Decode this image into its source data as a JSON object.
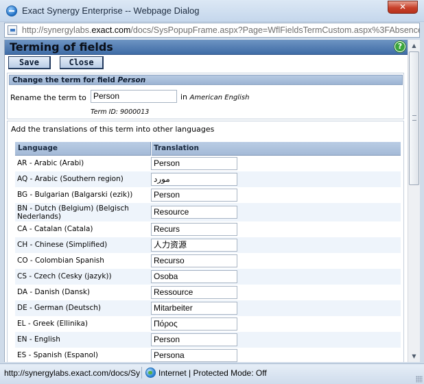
{
  "window": {
    "title": "Exact Synergy Enterprise -- Webpage Dialog",
    "close_glyph": "✕"
  },
  "address": {
    "url_prefix": "http://synergylabs.",
    "url_domain": "exact.com",
    "url_suffix": "/docs/SysPopupFrame.aspx?Page=WflFieldsTermCustom.aspx%3FAbsenceTyp"
  },
  "page": {
    "heading": "Terming of fields",
    "help_glyph": "?",
    "save_label": "Save",
    "close_label": "Close"
  },
  "change_term": {
    "header_prefix": "Change the term for field ",
    "field_name": "Person",
    "rename_label": "Rename the term to",
    "rename_value": "Person",
    "in_prefix": "in ",
    "language": "American English",
    "term_id": "Term ID: 9000013"
  },
  "translations": {
    "intro": "Add the translations of this term into other languages",
    "col_language": "Language",
    "col_translation": "Translation",
    "rows": [
      {
        "language": "AR - Arabic (Arabi)",
        "value": "Person"
      },
      {
        "language": "AQ - Arabic (Southern region)",
        "value": "مورد"
      },
      {
        "language": "BG - Bulgarian (Balgarski (ezik))",
        "value": "Person"
      },
      {
        "language": "BN - Dutch (Belgium) (Belgisch Nederlands)",
        "value": "Resource"
      },
      {
        "language": "CA - Catalan (Catala)",
        "value": "Recurs"
      },
      {
        "language": "CH - Chinese (Simplified)",
        "value": "人力资源"
      },
      {
        "language": "CO - Colombian Spanish",
        "value": "Recurso"
      },
      {
        "language": "CS - Czech (Cesky (jazyk))",
        "value": "Osoba"
      },
      {
        "language": "DA - Danish (Dansk)",
        "value": "Ressource"
      },
      {
        "language": "DE - German (Deutsch)",
        "value": "Mitarbeiter"
      },
      {
        "language": "EL - Greek (Ellinika)",
        "value": "Πόρος"
      },
      {
        "language": "EN - English",
        "value": "Person"
      },
      {
        "language": "ES - Spanish (Espanol)",
        "value": "Persona"
      }
    ]
  },
  "status": {
    "url": "http://synergylabs.exact.com/docs/Sy",
    "zone": "Internet | Protected Mode: Off"
  }
}
